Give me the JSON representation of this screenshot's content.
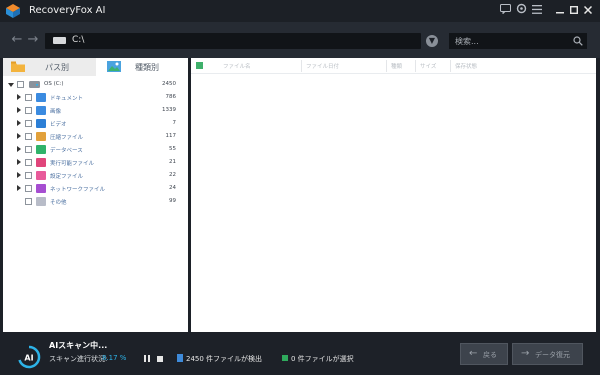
{
  "app": {
    "title": "RecoveryFox AI"
  },
  "titlebar_icons": [
    "chat-icon",
    "settings-icon",
    "menu-icon",
    "minimize-icon",
    "maximize-icon",
    "close-icon"
  ],
  "toolbar": {
    "path": "C:\\",
    "search_placeholder": "検索..."
  },
  "tabs": [
    {
      "label": "パス別",
      "icon": "folder-icon",
      "active": false
    },
    {
      "label": "種類別",
      "icon": "image-icon",
      "active": true
    }
  ],
  "tree": {
    "root": {
      "label": "OS (C:)",
      "count": "2450"
    },
    "items": [
      {
        "label": "ドキュメント",
        "count": "786",
        "icon": "document-folder-icon",
        "color": "#3b8be0"
      },
      {
        "label": "画像",
        "count": "1339",
        "icon": "image-folder-icon",
        "color": "#3b8be0"
      },
      {
        "label": "ビデオ",
        "count": "7",
        "icon": "video-folder-icon",
        "color": "#2c7fd6"
      },
      {
        "label": "圧縮ファイル",
        "count": "117",
        "icon": "archive-folder-icon",
        "color": "#e2a13b"
      },
      {
        "label": "データベース",
        "count": "55",
        "icon": "database-folder-icon",
        "color": "#2fb36a"
      },
      {
        "label": "実行可能ファイル",
        "count": "21",
        "icon": "executable-folder-icon",
        "color": "#e0457b"
      },
      {
        "label": "設定ファイル",
        "count": "22",
        "icon": "config-folder-icon",
        "color": "#e85a9a"
      },
      {
        "label": "ネットワークファイル",
        "count": "24",
        "icon": "network-folder-icon",
        "color": "#a64ed1"
      },
      {
        "label": "その他",
        "count": "99",
        "icon": "other-folder-icon",
        "color": "#b8bcc8"
      }
    ]
  },
  "file_table": {
    "columns": [
      "ファイル名",
      "ファイル日付",
      "種類",
      "サイズ",
      "保存状態"
    ]
  },
  "footer": {
    "scan_title": "AIスキャン中...",
    "scan_progress_label": "スキャン進行状況:",
    "scan_progress": "8.17 %",
    "files_found": "2450 件ファイルが検出",
    "files_selected": "0 件ファイルが選択",
    "back_label": "戻る",
    "recover_label": "データ復元"
  },
  "colors": {
    "accent": "#2db3e8",
    "background": "#1d2128",
    "panel": "#ffffff",
    "checkbox_green": "#3fb06b"
  }
}
